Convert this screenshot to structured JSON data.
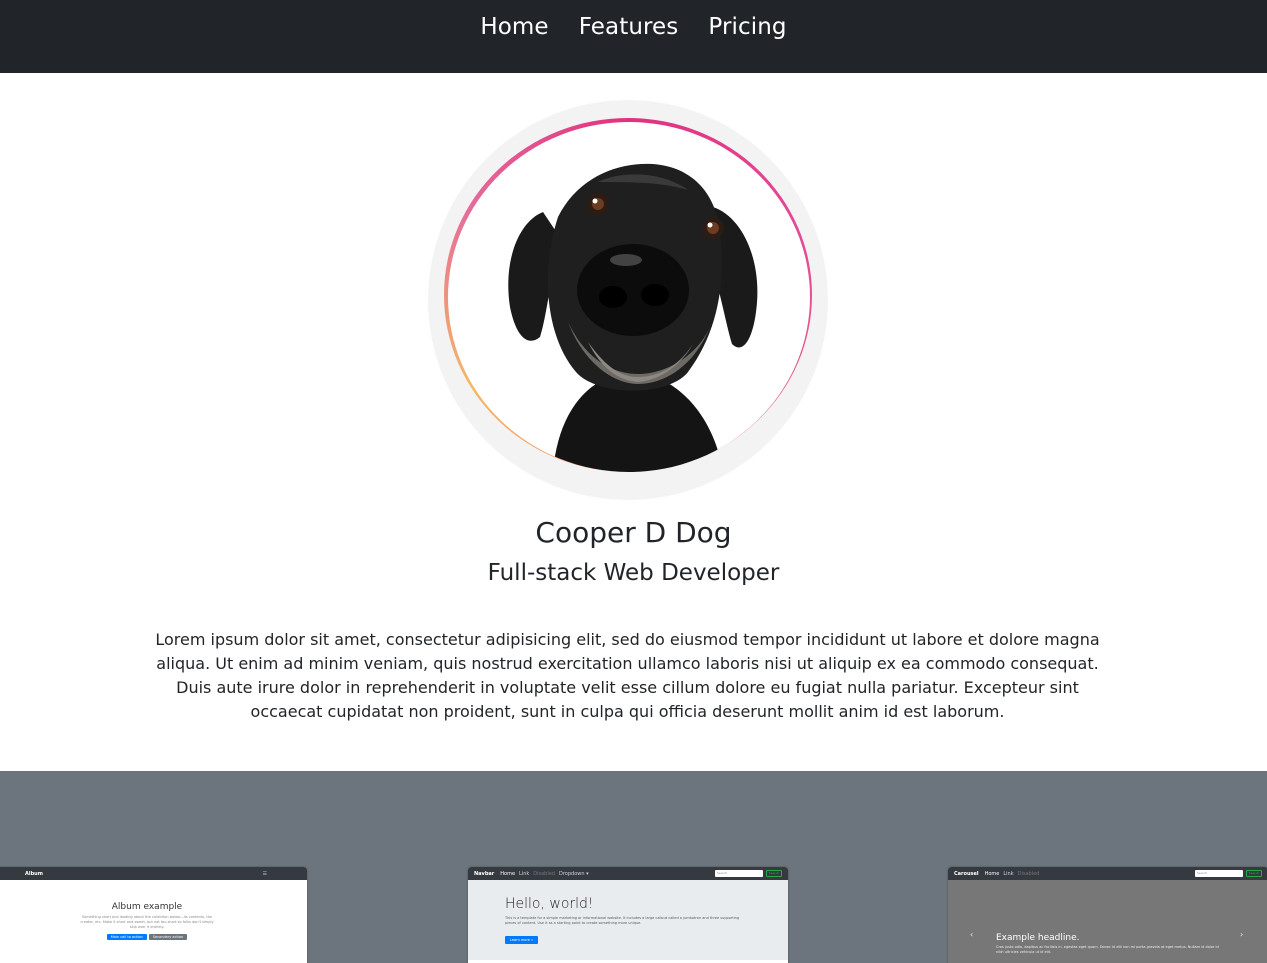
{
  "nav": {
    "items": [
      "Home",
      "Features",
      "Pricing"
    ]
  },
  "profile": {
    "name": "Cooper D Dog",
    "role": "Full-stack Web Developer",
    "bio": "Lorem ipsum dolor sit amet, consectetur adipisicing elit, sed do eiusmod tempor incididunt ut labore et dolore magna aliqua. Ut enim ad minim veniam, quis nostrud exercitation ullamco laboris nisi ut aliquip ex ea commodo consequat. Duis aute irure dolor in reprehenderit in voluptate velit esse cillum dolore eu fugiat nulla pariatur. Excepteur sint occaecat cupidatat non proident, sunt in culpa qui officia deserunt mollit anim id est laborum."
  },
  "thumbnails": {
    "album": {
      "brand": "Album",
      "title": "Album example",
      "text": "Something short and leading about the collection below—its contents, the creator, etc. Make it short and sweet, but not too short so folks don't simply skip over it entirely.",
      "primary_btn": "Main call to action",
      "secondary_btn": "Secondary action"
    },
    "navbar": {
      "brand": "Navbar",
      "items": [
        "Home",
        "Link",
        "Disabled",
        "Dropdown ▾"
      ],
      "search_placeholder": "Search",
      "search_btn": "Search",
      "title": "Hello, world!",
      "text": "This is a template for a simple marketing or informational website. It includes a large callout called a jumbotron and three supporting pieces of content. Use it as a starting point to create something more unique.",
      "btn": "Learn more »"
    },
    "carousel": {
      "brand": "Carousel",
      "items": [
        "Home",
        "Link",
        "Disabled"
      ],
      "search_placeholder": "Search",
      "search_btn": "Search",
      "headline": "Example headline.",
      "text": "Cras justo odio, dapibus ac facilisis in, egestas eget quam. Donec id elit non mi porta gravida at eget metus. Nullam id dolor id nibh ultricies vehicula ut id elit."
    }
  },
  "colors": {
    "navbar_bg": "#212529",
    "band_bg": "#6c757d",
    "ring_pink": "#e0327f",
    "ring_orange": "#f5b865"
  }
}
